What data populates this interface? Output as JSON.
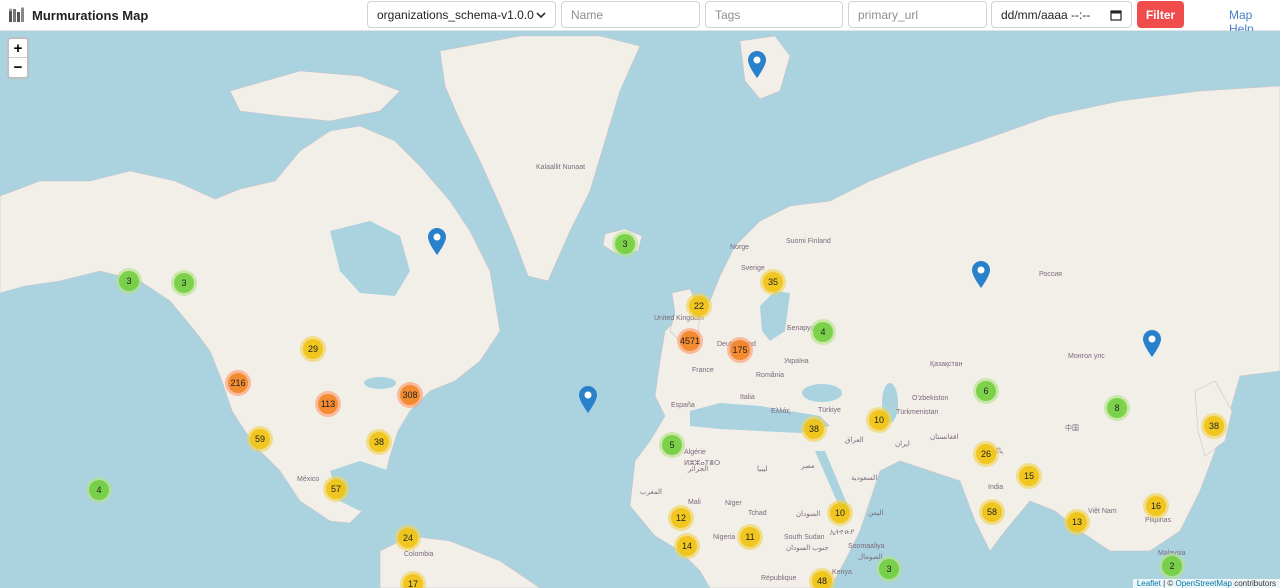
{
  "header": {
    "title": "Murmurations Map",
    "schema_select": "organizations_schema-v1.0.0",
    "name_placeholder": "Name",
    "tags_placeholder": "Tags",
    "url_placeholder": "primary_url",
    "date_placeholder": "dd/mm/aaaa --:--",
    "filter_label": "Filter",
    "help_label": "Map Help"
  },
  "map": {
    "zoom_in": "+",
    "zoom_out": "−",
    "clusters": [
      {
        "count": "3",
        "size": "small"
      },
      {
        "count": "3",
        "size": "small"
      },
      {
        "count": "29",
        "size": "medium"
      },
      {
        "count": "216",
        "size": "large"
      },
      {
        "count": "113",
        "size": "large"
      },
      {
        "count": "308",
        "size": "large"
      },
      {
        "count": "59",
        "size": "medium"
      },
      {
        "count": "38",
        "size": "medium"
      },
      {
        "count": "57",
        "size": "medium"
      },
      {
        "count": "4",
        "size": "small"
      },
      {
        "count": "24",
        "size": "medium"
      },
      {
        "count": "17",
        "size": "medium"
      },
      {
        "count": "3",
        "size": "small"
      },
      {
        "count": "22",
        "size": "medium"
      },
      {
        "count": "35",
        "size": "medium"
      },
      {
        "count": "4571",
        "size": "large"
      },
      {
        "count": "175",
        "size": "large"
      },
      {
        "count": "4",
        "size": "small"
      },
      {
        "count": "5",
        "size": "small"
      },
      {
        "count": "12",
        "size": "medium"
      },
      {
        "count": "14",
        "size": "medium"
      },
      {
        "count": "11",
        "size": "medium"
      },
      {
        "count": "10",
        "size": "medium"
      },
      {
        "count": "38",
        "size": "medium"
      },
      {
        "count": "10",
        "size": "medium"
      },
      {
        "count": "6",
        "size": "small"
      },
      {
        "count": "8",
        "size": "small"
      },
      {
        "count": "38",
        "size": "medium"
      },
      {
        "count": "26",
        "size": "medium"
      },
      {
        "count": "15",
        "size": "medium"
      },
      {
        "count": "58",
        "size": "medium"
      },
      {
        "count": "13",
        "size": "medium"
      },
      {
        "count": "16",
        "size": "medium"
      },
      {
        "count": "2",
        "size": "small"
      },
      {
        "count": "3",
        "size": "small"
      },
      {
        "count": "48",
        "size": "medium"
      }
    ],
    "labels": [
      "Kalaallit Nunaat",
      "Norge",
      "Suomi Finland",
      "Sverige",
      "Россия",
      "United Kingdom",
      "Deutschland",
      "Беларусь",
      "France",
      "Україна",
      "România",
      "España",
      "Italia",
      "Ελλάς",
      "Türkiye",
      "Қазақстан",
      "Монгол улс",
      "O'zbekiston",
      "Türkmenistan",
      "العراق",
      "ایران",
      "افغانستان",
      "پاکستان",
      "中国",
      "India",
      "Việt Nam",
      "Pilipinas",
      "Malaysia",
      "México",
      "Colombia",
      "Algérie",
      "ⵍⵣⵣⴰⵢⴻⵔ",
      "الجزائر",
      "ليبيا",
      "مصر",
      "السعودية",
      "المغرب",
      "Mali",
      "Niger",
      "Tchad",
      "السودان",
      "Nigeria",
      "South Sudan",
      "جنوب السودان",
      "ኢትዮጵያ",
      "Soomaaliya",
      "الصومال",
      "Kenya",
      "République",
      "اليمن"
    ],
    "attribution_leaflet": "Leaflet",
    "attribution_sep": " | © ",
    "attribution_osm": "OpenStreetMap",
    "attribution_tail": " contributors"
  }
}
